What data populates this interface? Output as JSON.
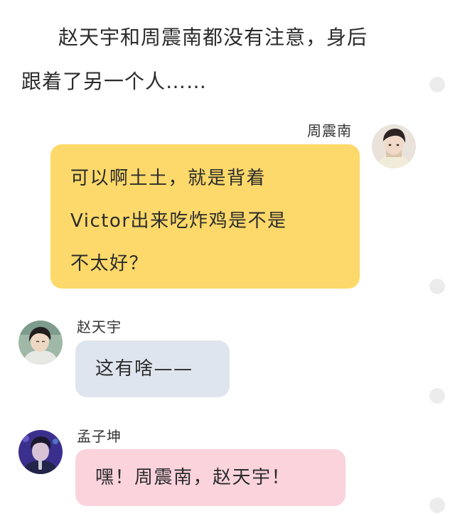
{
  "narration": {
    "line1": "赵天宇和周震南都没有注意，身后",
    "line2": "跟着了另一个人……"
  },
  "messages": [
    {
      "sender": "周震南",
      "lines": [
        "可以啊土土，就是背着",
        "Victor出来吃炸鸡是不是",
        "不太好？"
      ],
      "bubble_color": "#fcd96a",
      "side": "right"
    },
    {
      "sender": "赵天宇",
      "text": "这有啥——",
      "bubble_color": "#dfe5ee",
      "side": "left"
    },
    {
      "sender": "孟子坤",
      "text": "嘿！周震南，赵天宇！",
      "bubble_color": "#fad3dd",
      "side": "left"
    }
  ],
  "avatars": {
    "zhouzhennan": "avatar-zhouzhennan",
    "zhaotianyu": "avatar-zhaotianyu",
    "mengzikun": "avatar-mengzikun"
  }
}
